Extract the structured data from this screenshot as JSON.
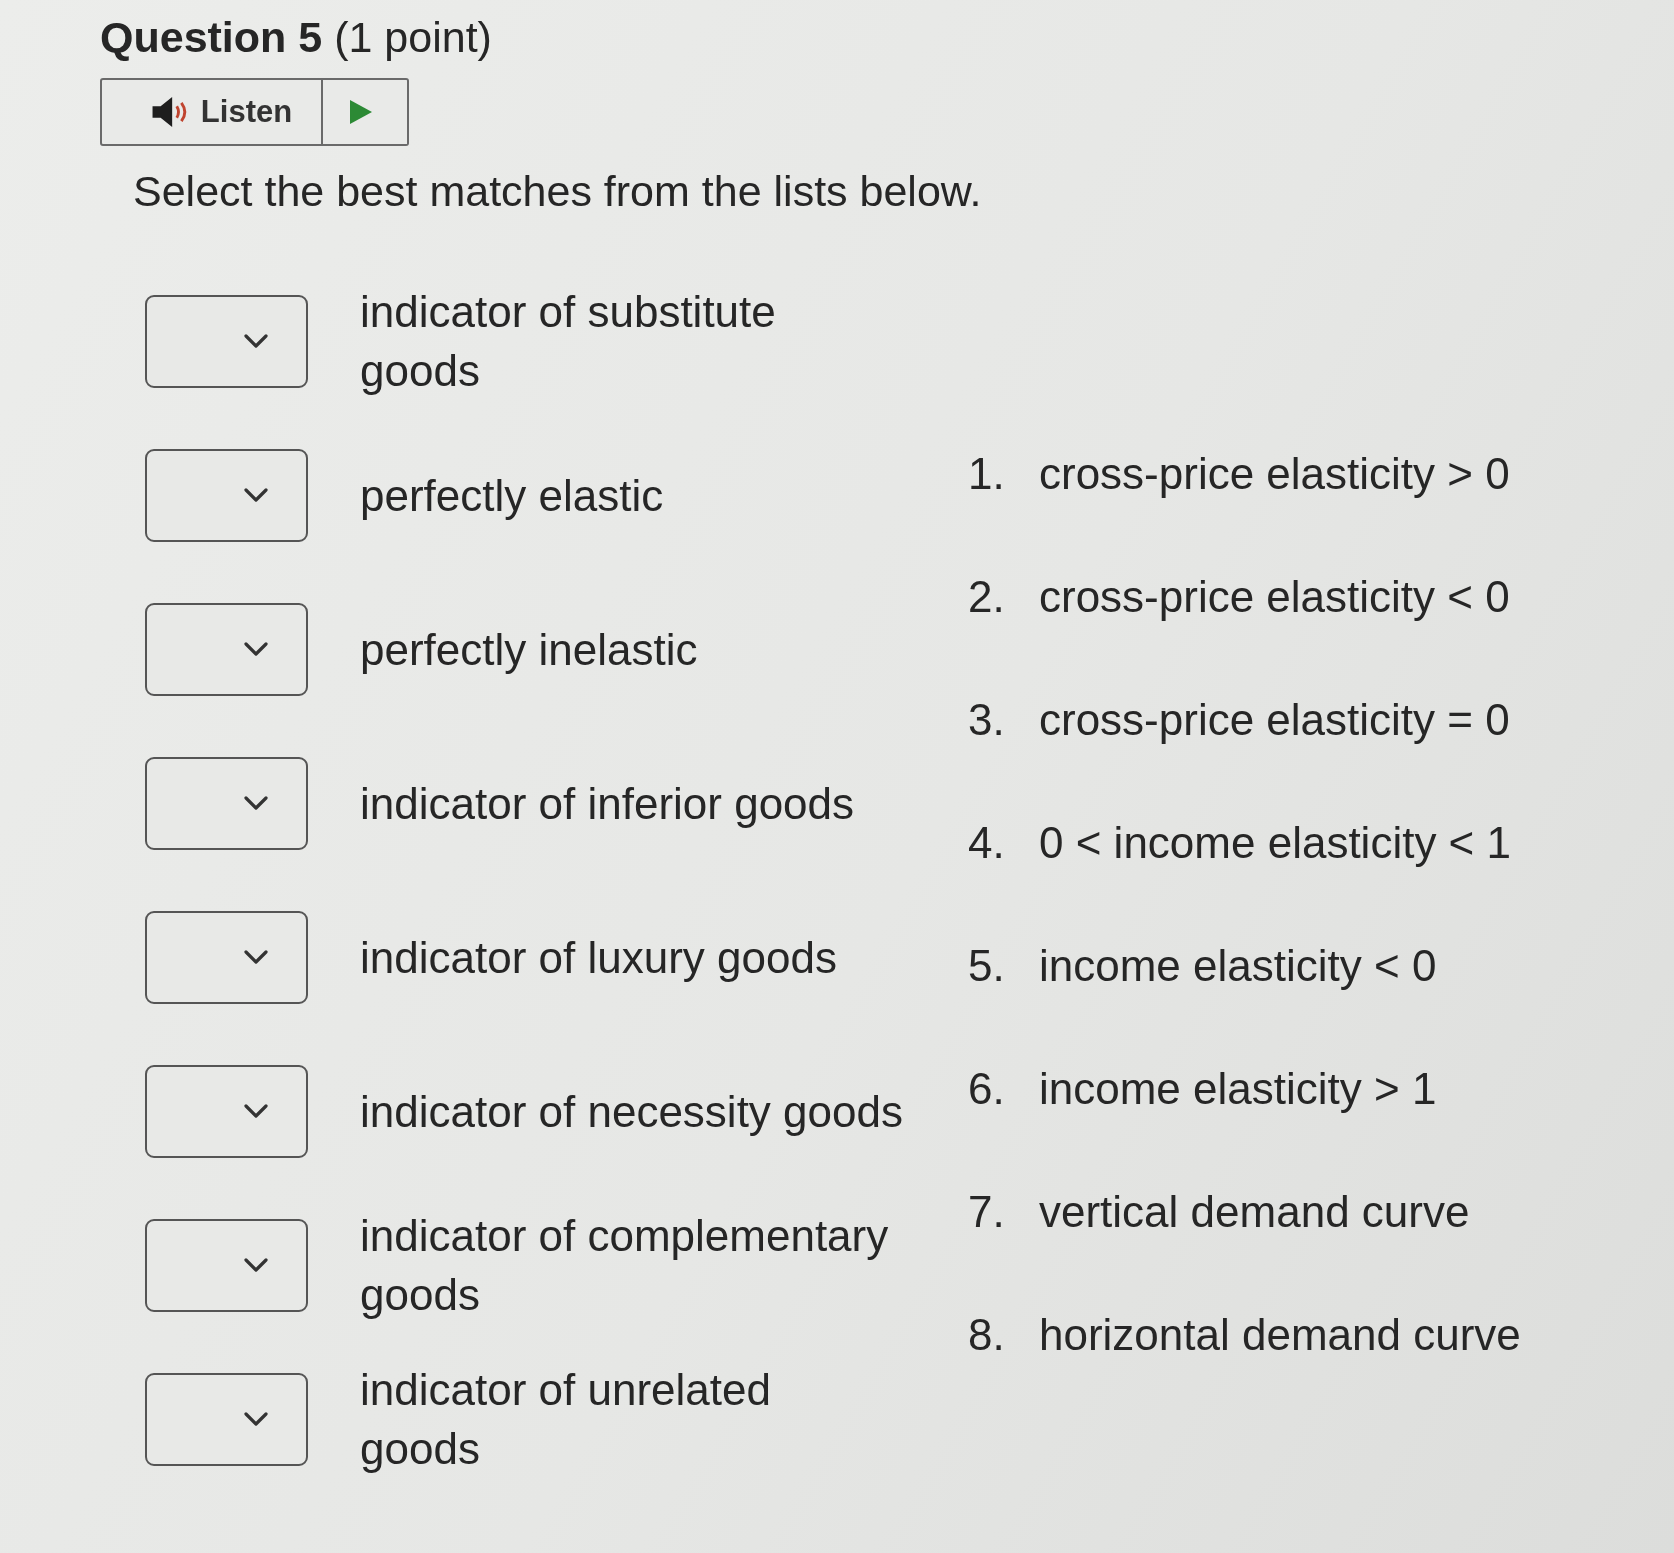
{
  "question": {
    "title": "**Question 5** (1 point)"
  },
  "listen": {
    "label": "Listen"
  },
  "instruction": "Select the best matches from the lists below.",
  "matches": [
    {
      "lines": [
        "indicator of substitute",
        "goods"
      ]
    },
    {
      "lines": [
        "perfectly elastic"
      ]
    },
    {
      "lines": [
        "perfectly inelastic"
      ]
    },
    {
      "lines": [
        "indicator of inferior goods"
      ]
    },
    {
      "lines": [
        "indicator of luxury goods"
      ]
    },
    {
      "lines": [
        "indicator of necessity goods"
      ]
    },
    {
      "lines": [
        "indicator of complementary",
        "goods"
      ]
    },
    {
      "lines": [
        "indicator of unrelated",
        "goods"
      ]
    }
  ],
  "options": [
    {
      "number": "1.",
      "text": "cross-price elasticity > 0"
    },
    {
      "number": "2.",
      "text": "cross-price elasticity < 0"
    },
    {
      "number": "3.",
      "text": "cross-price elasticity = 0"
    },
    {
      "number": "4.",
      "text": "0 < income elasticity < 1"
    },
    {
      "number": "5.",
      "text": "income elasticity < 0"
    },
    {
      "number": "6.",
      "text": "income elasticity > 1"
    },
    {
      "number": "7.",
      "text": "vertical demand curve"
    },
    {
      "number": "8.",
      "text": "horizontal demand curve"
    }
  ]
}
